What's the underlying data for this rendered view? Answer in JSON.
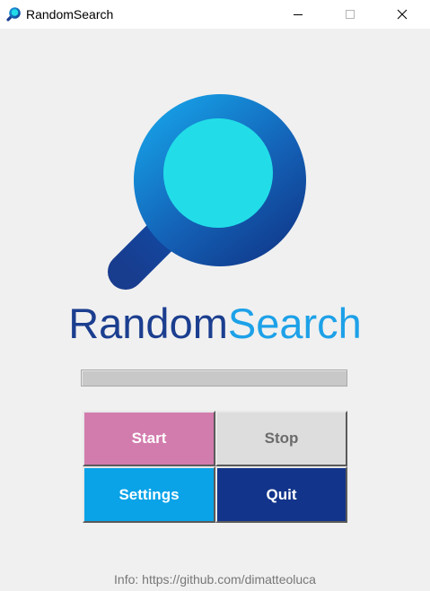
{
  "window": {
    "title": "RandomSearch",
    "controls": [
      "minimize",
      "maximize",
      "close"
    ]
  },
  "icons": {
    "app": "magnifier-icon",
    "minimize": "minimize-icon",
    "maximize": "maximize-icon",
    "close": "close-icon",
    "logo": "magnifier-logo-icon"
  },
  "logo": {
    "word_part1": "Random",
    "word_part2": "Search",
    "colors": {
      "dark_blue": "#1b3e8f",
      "light_blue": "#1da1e8",
      "lens": "#22dde8"
    }
  },
  "progress": {
    "value": 0
  },
  "buttons": {
    "start": "Start",
    "stop": "Stop",
    "settings": "Settings",
    "quit": "Quit"
  },
  "button_colors": {
    "start": "#d27bad",
    "stop": "#dddddd",
    "settings": "#0aa3e8",
    "quit": "#12348a"
  },
  "footer": {
    "info": "Info: https://github.com/dimatteoluca"
  }
}
